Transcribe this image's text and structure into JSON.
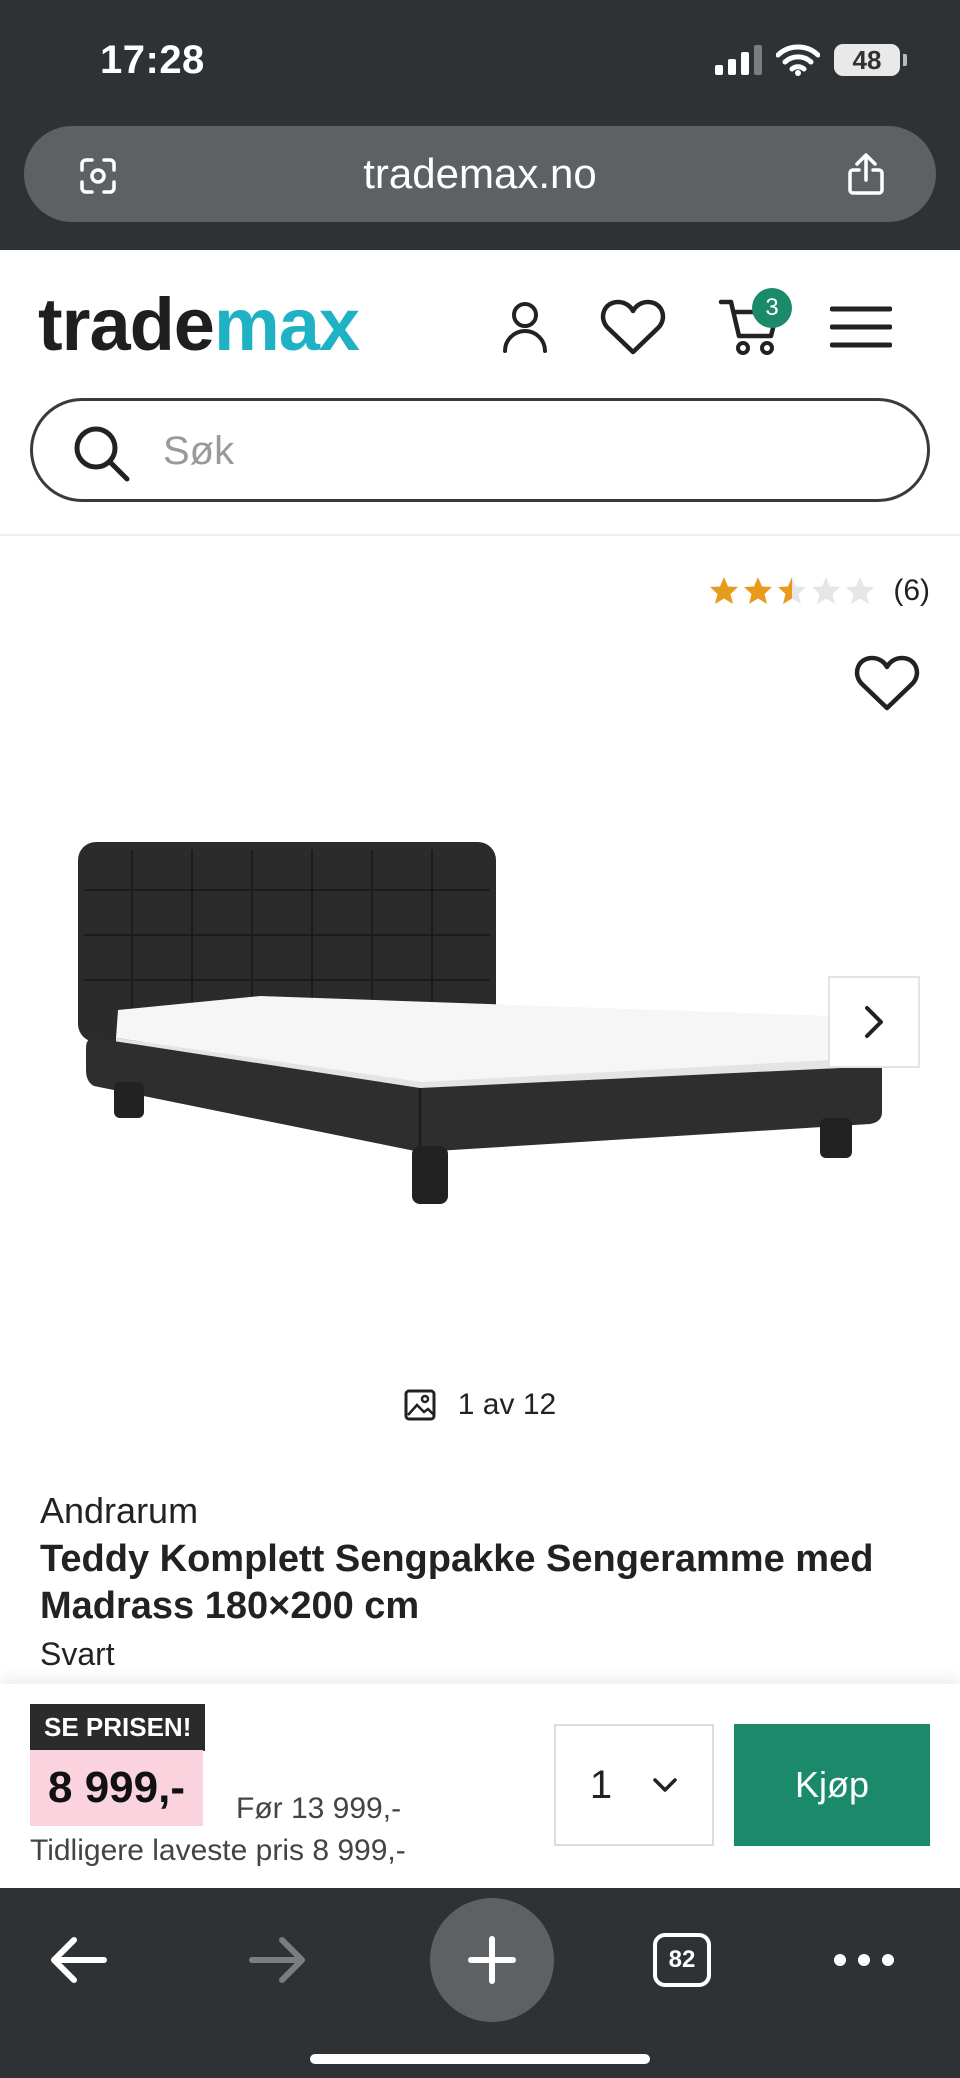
{
  "status_bar": {
    "time": "17:28",
    "battery": "48"
  },
  "browser": {
    "url": "trademax.no",
    "tabs_count": "82"
  },
  "header": {
    "logo_part1": "trade",
    "logo_part2": "max",
    "cart_count": "3",
    "search_placeholder": "Søk",
    "accent_color": "#1fb2c5",
    "brand_green": "#1b8a6b"
  },
  "product": {
    "rating_stars": 2.5,
    "rating_max": 5,
    "rating_count": "(6)",
    "gallery_counter": "1 av 12",
    "brand": "Andrarum",
    "title": "Teddy Komplett Sengpakke Sengeramme med Madrass 180×200 cm",
    "variant": "Svart"
  },
  "buy_bar": {
    "promo_label": "SE PRISEN!",
    "price": "8 999,-",
    "before_price": "Før 13 999,-",
    "lowest_price": "Tidligere laveste pris 8 999,-",
    "quantity": "1",
    "buy_label": "Kjøp"
  },
  "icons": {
    "url_left": "page-scan-icon",
    "url_right": "share-icon",
    "account": "user-icon",
    "wishlist": "heart-icon",
    "cart": "cart-icon",
    "menu": "hamburger-menu-icon",
    "search": "search-icon",
    "gallery": "image-icon",
    "next": "chevron-right-icon",
    "back": "arrow-left-icon",
    "forward": "arrow-right-icon",
    "new_tab": "plus-icon",
    "more": "more-dots-icon"
  }
}
